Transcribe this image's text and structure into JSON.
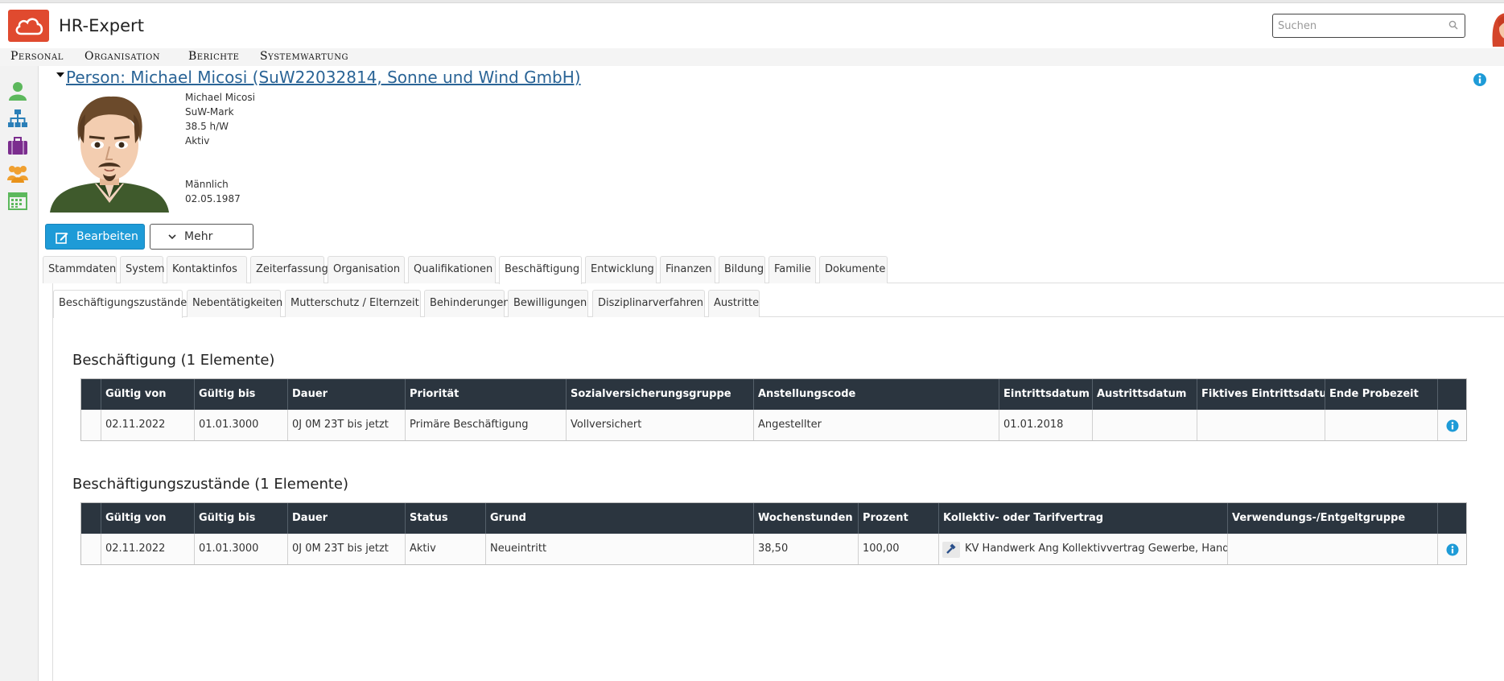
{
  "app": {
    "title": "HR-Expert"
  },
  "search": {
    "placeholder": "Suchen"
  },
  "menu": [
    "Personal",
    "Organisation",
    "Berichte",
    "Systemwartung"
  ],
  "sidebar_icons": [
    "person-icon",
    "org-chart-icon",
    "briefcase-icon",
    "group-icon",
    "calendar-icon"
  ],
  "person": {
    "title": "Person: Michael Micosi (SuW22032814, Sonne und Wind GmbH)",
    "name": "Michael Micosi",
    "location": "SuW-Mark",
    "hours": "38.5 h/W",
    "status": "Aktiv",
    "gender": "Männlich",
    "birthdate": "02.05.1987"
  },
  "actions": {
    "edit_label": "Bearbeiten",
    "more_label": "Mehr"
  },
  "tabs": [
    "Stammdaten",
    "System",
    "Kontaktinfos",
    "Zeiterfassung",
    "Organisation",
    "Qualifikationen",
    "Beschäftigung",
    "Entwicklung",
    "Finanzen",
    "Bildung",
    "Familie",
    "Dokumente"
  ],
  "active_tab": "Beschäftigung",
  "subtabs": [
    "Beschäftigungszustände",
    "Nebentätigkeiten",
    "Mutterschutz / Elternzeit",
    "Behinderungen",
    "Bewilligungen",
    "Disziplinarverfahren",
    "Austritte"
  ],
  "active_subtab": "Beschäftigungszustände",
  "employment": {
    "title": "Beschäftigung (1 Elemente)",
    "columns": [
      "Gültig von",
      "Gültig bis",
      "Dauer",
      "Priorität",
      "Sozialversicherungsgruppe",
      "Anstellungscode",
      "Eintrittsdatum",
      "Austrittsdatum",
      "Fiktives Eintrittsdatum",
      "Ende Probezeit"
    ],
    "rows": [
      [
        "02.11.2022",
        "01.01.3000",
        "0J 0M 23T bis jetzt",
        "Primäre Beschäftigung",
        "Vollversichert",
        "Angestellter",
        "01.01.2018",
        "",
        "",
        ""
      ]
    ]
  },
  "states": {
    "title": "Beschäftigungszustände (1 Elemente)",
    "columns": [
      "Gültig von",
      "Gültig bis",
      "Dauer",
      "Status",
      "Grund",
      "Wochenstunden",
      "Prozent",
      "Kollektiv- oder Tarifvertrag",
      "Verwendungs-/Entgeltgruppe"
    ],
    "rows": [
      [
        "02.11.2022",
        "01.01.3000",
        "0J 0M 23T bis jetzt",
        "Aktiv",
        "Neueintritt",
        "38,50",
        "100,00",
        "KV Handwerk Ang Kollektivvertrag Gewerbe, Handwerk",
        ""
      ]
    ]
  },
  "colors": {
    "accent": "#1e9bd7",
    "brand": "#e04a2f",
    "grid_header": "#2b353f",
    "link": "#2a6496"
  }
}
